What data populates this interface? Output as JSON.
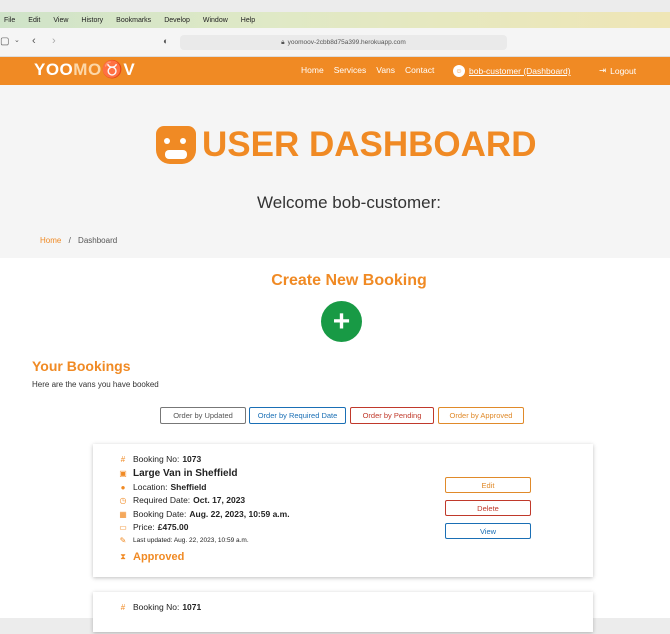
{
  "menu": [
    "File",
    "Edit",
    "View",
    "History",
    "Bookmarks",
    "Develop",
    "Window",
    "Help"
  ],
  "browser": {
    "url": "yoomoov-2cbb8d75a399.herokuapp.com"
  },
  "nav": {
    "logo_main": "YOO",
    "logo_faded": "MO",
    "logo_end": "V",
    "links": [
      "Home",
      "Services",
      "Vans",
      "Contact"
    ],
    "user_link": "bob-customer (Dashboard)",
    "logout": "Logout"
  },
  "hero": {
    "title": "USER DASHBOARD",
    "welcome": "Welcome bob-customer:"
  },
  "breadcrumb": {
    "home": "Home",
    "separator": "/",
    "current": "Dashboard"
  },
  "create": {
    "title": "Create New Booking",
    "button": "+"
  },
  "bookings": {
    "title": "Your Bookings",
    "subtitle": "Here are the vans you have booked",
    "order_buttons": [
      {
        "label": "Order by Updated",
        "color": "#555555"
      },
      {
        "label": "Order by Required Date",
        "color": "#1a6fb5"
      },
      {
        "label": "Order by Pending",
        "color": "#c0392b"
      },
      {
        "label": "Order by Approved",
        "color": "#e08a2a"
      }
    ],
    "items": [
      {
        "booking_no_label": "Booking No:",
        "booking_no": "1073",
        "van": "Large Van in Sheffield",
        "location_label": "Location:",
        "location": "Sheffield",
        "required_label": "Required Date:",
        "required": "Oct. 17, 2023",
        "booking_date_label": "Booking Date:",
        "booking_date": "Aug. 22, 2023, 10:59 a.m.",
        "price_label": "Price:",
        "price": "£475.00",
        "updated": "Last updated: Aug. 22, 2023, 10:59 a.m.",
        "status": "Approved",
        "actions": {
          "edit": "Edit",
          "delete": "Delete",
          "view": "View"
        }
      },
      {
        "booking_no_label": "Booking No:",
        "booking_no": "1071"
      }
    ]
  },
  "colors": {
    "brand": "#f08a24",
    "green": "#189a45"
  }
}
